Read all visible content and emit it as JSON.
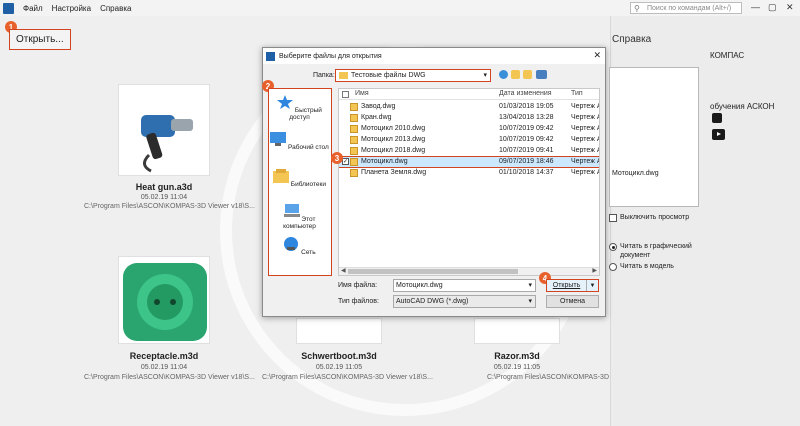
{
  "menubar": {
    "items": [
      "Файл",
      "Настройка",
      "Справка"
    ],
    "search_placeholder": "Поиск по командам (Alt+/)",
    "window_buttons": [
      "—",
      "▢",
      "✕"
    ]
  },
  "toolbar": {
    "open_label": "Открыть..."
  },
  "markers": [
    "1",
    "2",
    "3",
    "4"
  ],
  "recent_files": [
    {
      "title": "Heat gun.a3d",
      "date": "05.02.19 11:04",
      "path": "C:\\Program Files\\ASCON\\KOMPAS-3D Viewer v18\\S..."
    },
    {
      "title": "Receptacle.m3d",
      "date": "05.02.19 11:04",
      "path": "C:\\Program Files\\ASCON\\KOMPAS-3D Viewer v18\\S..."
    },
    {
      "title": "Schwertboot.m3d",
      "date": "05.02.19 11:05",
      "path": "C:\\Program Files\\ASCON\\KOMPAS-3D Viewer v18\\S..."
    },
    {
      "title": "Razor.m3d",
      "date": "05.02.19 11:05",
      "path": "C:\\Program Files\\ASCON\\KOMPAS-3D Viewer v18\\S..."
    }
  ],
  "right_panel": {
    "title": "Справка",
    "links": [
      "КОМПАС",
      "обучения АСКОН"
    ]
  },
  "dialog": {
    "title": "Выберите файлы для открытия",
    "close": "✕",
    "folder_label": "Папка:",
    "folder_value": "Тестовые файлы DWG",
    "places": [
      "Быстрый доступ",
      "Рабочий стол",
      "Библиотеки",
      "Этот компьютер",
      "Сеть"
    ],
    "columns": [
      "Имя",
      "Дата изменения",
      "Тип"
    ],
    "files": [
      {
        "name": "Завод.dwg",
        "date": "01/03/2018 19:05",
        "type": "Чертеж А"
      },
      {
        "name": "Кран.dwg",
        "date": "13/04/2018 13:28",
        "type": "Чертеж А"
      },
      {
        "name": "Мотоцикл 2010.dwg",
        "date": "10/07/2019 09:42",
        "type": "Чертеж А"
      },
      {
        "name": "Мотоцикл 2013.dwg",
        "date": "10/07/2019 09:42",
        "type": "Чертеж А"
      },
      {
        "name": "Мотоцикл 2018.dwg",
        "date": "10/07/2019 09:41",
        "type": "Чертеж А"
      },
      {
        "name": "Мотоцикл.dwg",
        "date": "09/07/2019 18:46",
        "type": "Чертеж А"
      },
      {
        "name": "Планета Земля.dwg",
        "date": "01/10/2018 14:37",
        "type": "Чертеж А"
      }
    ],
    "selected_index": 5,
    "filename_label": "Имя файла:",
    "filename_value": "Мотоцикл.dwg",
    "filetype_label": "Тип файлов:",
    "filetype_value": "AutoCAD DWG (*.dwg)",
    "open_button": "Открыть",
    "cancel_button": "Отмена",
    "preview_filename": "Мотоцикл.dwg",
    "disable_preview_label": "Выключить просмотр",
    "radio_graphic_label": "Читать в графический документ",
    "radio_model_label": "Читать в модель",
    "radio_selected": "graphic"
  },
  "colors": {
    "highlight": "#d0441f",
    "marker": "#e8612c",
    "selection": "#cce8ff",
    "accent": "#1f5fa6"
  }
}
